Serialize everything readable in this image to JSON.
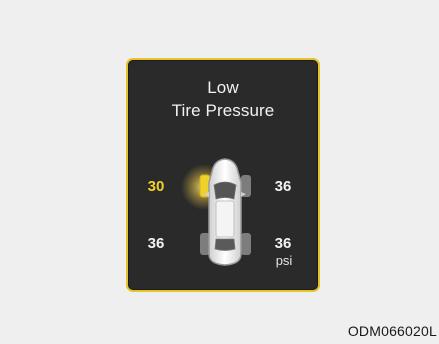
{
  "display": {
    "title_line1": "Low",
    "title_line2": "Tire Pressure",
    "unit": "psi"
  },
  "tires": {
    "front_left": {
      "value": "30",
      "status": "low"
    },
    "front_right": {
      "value": "36",
      "status": "normal"
    },
    "rear_left": {
      "value": "36",
      "status": "normal"
    },
    "rear_right": {
      "value": "36",
      "status": "normal"
    }
  },
  "figure_code": "ODM066020L",
  "colors": {
    "background": "#efefef",
    "panel_background": "#2a2a2a",
    "panel_border": "#e6c32a",
    "warning_text": "#f0d12a",
    "normal_text": "#f2f2f2"
  },
  "icons": {
    "vehicle": "car-top-view-icon",
    "low_tire_indicator": "tire-warning-icon"
  }
}
